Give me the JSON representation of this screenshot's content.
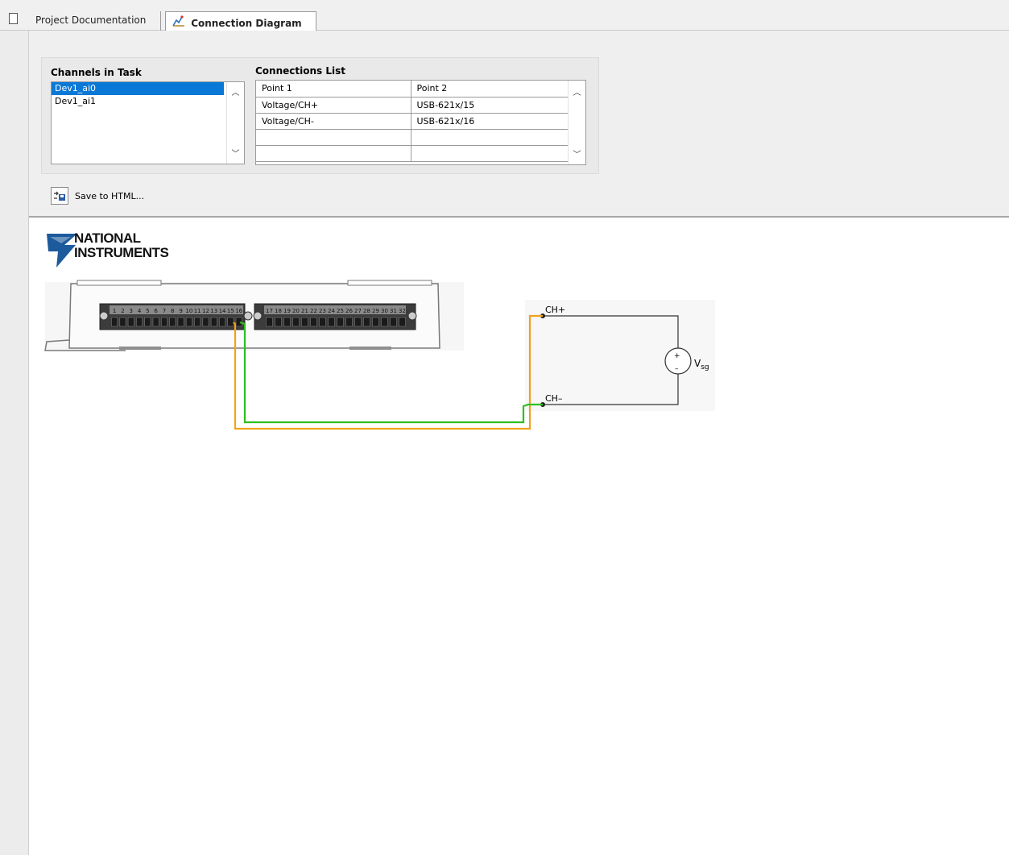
{
  "tabs": [
    {
      "label": "Project Documentation",
      "active": false
    },
    {
      "label": "Connection Diagram",
      "active": true
    }
  ],
  "channels": {
    "title": "Channels in Task",
    "items": [
      "Dev1_ai0",
      "Dev1_ai1"
    ],
    "selected_index": 0
  },
  "connections": {
    "title": "Connections List",
    "headers": [
      "Point 1",
      "Point 2"
    ],
    "rows": [
      [
        "Voltage/CH+",
        "USB-621x/15"
      ],
      [
        "Voltage/CH-",
        "USB-621x/16"
      ],
      [
        "",
        ""
      ],
      [
        "",
        ""
      ]
    ]
  },
  "save_button": {
    "label": "Save to HTML..."
  },
  "logo": {
    "line1": "NATIONAL",
    "line2": "INSTRUMENTS"
  },
  "device": {
    "terminals_left": [
      "1",
      "2",
      "3",
      "4",
      "5",
      "6",
      "7",
      "8",
      "9",
      "10",
      "11",
      "12",
      "13",
      "14",
      "15",
      "16"
    ],
    "terminals_right": [
      "17",
      "18",
      "19",
      "20",
      "21",
      "22",
      "23",
      "24",
      "25",
      "26",
      "27",
      "28",
      "29",
      "30",
      "31",
      "32"
    ]
  },
  "circuit": {
    "ch_plus": "CH+",
    "ch_minus": "CH–",
    "source_label": "V",
    "source_subscript": "sg",
    "plus_sign": "+",
    "minus_sign": "–"
  },
  "colors": {
    "wire_plus": "#f0a21a",
    "wire_minus": "#2fbf1f",
    "selection": "#0a78d7"
  }
}
